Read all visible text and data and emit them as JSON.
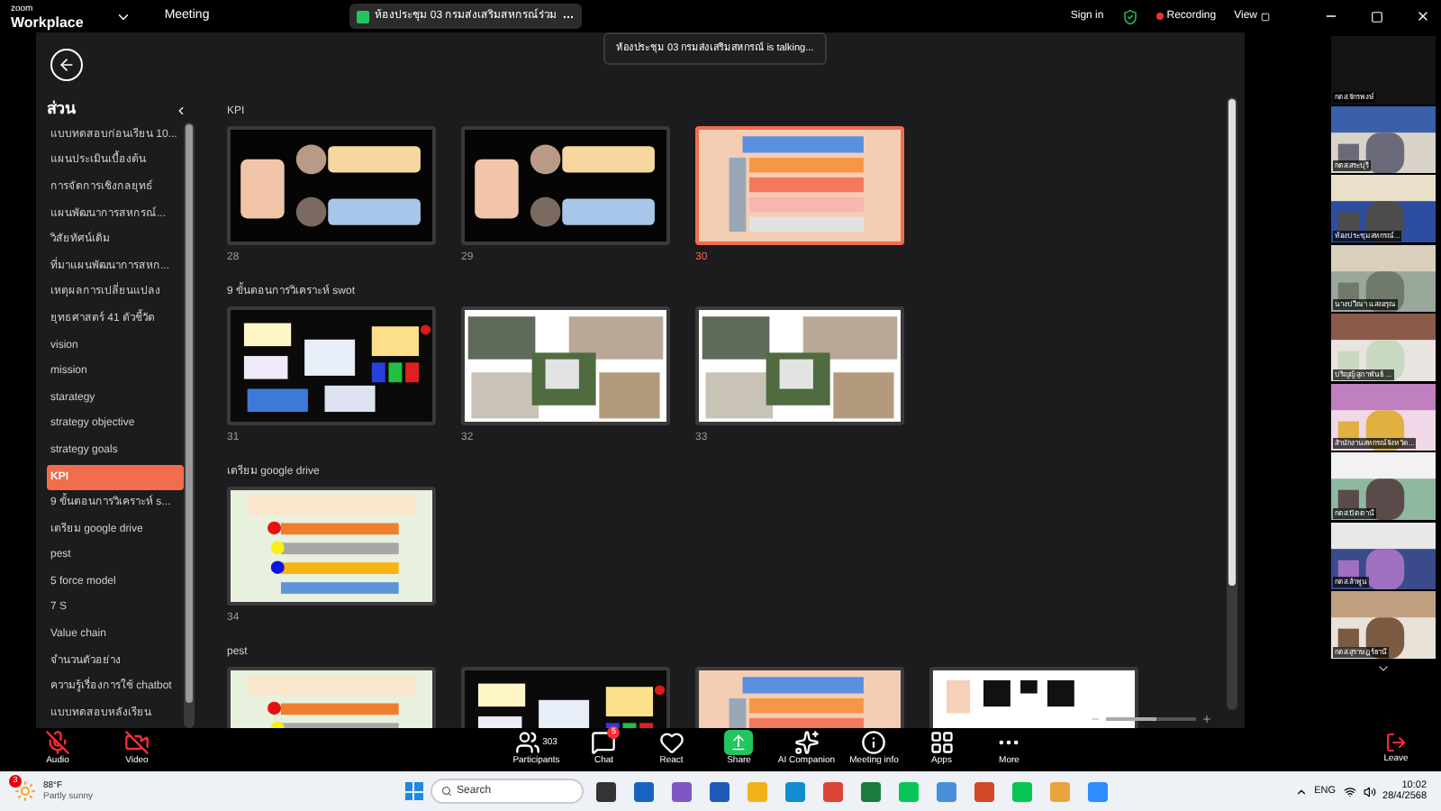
{
  "titlebar": {
    "brand_top": "zoom",
    "brand": "Workplace",
    "meeting": "Meeting",
    "room_pill": "ห้องประชุม 03 กรมส่งเสริมสหกรณ์ร่วม",
    "sign_in": "Sign in",
    "recording": "Recording",
    "view": "View"
  },
  "toast": "ห้องประชุม 03 กรมส่งเสริมสหกรณ์ is talking...",
  "sidebar": {
    "title": "ส่วน",
    "items": [
      {
        "label": "แบบทดสอบก่อนเรียน 10...",
        "selected": false
      },
      {
        "label": "แผนประเมินเบื้องต้น",
        "selected": false
      },
      {
        "label": "การจัดการเชิงกลยุทธ์",
        "selected": false
      },
      {
        "label": "แผนพัฒนาการสหกรณ์...",
        "selected": false
      },
      {
        "label": "วิสัยทัศน์เดิม",
        "selected": false
      },
      {
        "label": "ที่มาแผนพัฒนาการสหก...",
        "selected": false
      },
      {
        "label": "เหตุผลการเปลี่ยนแปลง",
        "selected": false
      },
      {
        "label": "ยุทธศาสตร์ 41 ตัวชี้วัด",
        "selected": false
      },
      {
        "label": "vision",
        "selected": false
      },
      {
        "label": "mission",
        "selected": false
      },
      {
        "label": "starategy",
        "selected": false
      },
      {
        "label": "strategy objective",
        "selected": false
      },
      {
        "label": "strategy goals",
        "selected": false
      },
      {
        "label": "KPI",
        "selected": true
      },
      {
        "label": "9 ขั้นตอนการวิเคราะห์ s...",
        "selected": false
      },
      {
        "label": "เตรียม google drive",
        "selected": false
      },
      {
        "label": "pest",
        "selected": false
      },
      {
        "label": "5 force model",
        "selected": false
      },
      {
        "label": "7 S",
        "selected": false
      },
      {
        "label": "Value chain",
        "selected": false
      },
      {
        "label": "จำนวนตัวอย่าง",
        "selected": false
      },
      {
        "label": "ความรู้เรื่องการใช้ chatbot",
        "selected": false
      },
      {
        "label": "แบบทดสอบหลังเรียน",
        "selected": false
      }
    ]
  },
  "sections": [
    {
      "title": "KPI",
      "slides": [
        {
          "number": "28",
          "kind": "kpi",
          "selected": false
        },
        {
          "number": "29",
          "kind": "kpi",
          "selected": false
        },
        {
          "number": "30",
          "kind": "keyword",
          "selected": true
        }
      ]
    },
    {
      "title": "9 ขั้นตอนการวิเคราะห์ swot",
      "slides": [
        {
          "number": "31",
          "kind": "chart",
          "selected": false
        },
        {
          "number": "32",
          "selected": false
        },
        {
          "number": "33",
          "selected": false
        }
      ]
    },
    {
      "title": "เตรียม google drive",
      "slides": [
        {
          "number": "34",
          "kind": "list",
          "selected": false
        }
      ]
    },
    {
      "title": "pest",
      "slides": [
        {
          "kind": "list",
          "selected": false
        },
        {
          "kind": "chart",
          "selected": false
        },
        {
          "kind": "keyword",
          "selected": false
        },
        {
          "kind": "qr",
          "selected": false
        }
      ]
    }
  ],
  "zoom_slider": {
    "level": 0.55
  },
  "videos": [
    "กตส.จักรพงษ์",
    "กตส.สระบุรี",
    "ห้องประชุมสหกรณ์...",
    "นางปวีณา แสงอรุณ",
    "ปริญญ์ สุภาพันธ์ ...",
    "สำนักงานสหกรณ์จังหวัด...",
    "กตส.ปัตตานี",
    "กตส.ลำพูน",
    "กตส.สุราษฎร์ธานี"
  ],
  "toolbar": [
    {
      "label": "Audio",
      "kind": "audio"
    },
    {
      "label": "Video",
      "kind": "video"
    },
    {
      "label": "Participants",
      "kind": "participants",
      "count": "303"
    },
    {
      "label": "Chat",
      "kind": "chat",
      "badge": "5"
    },
    {
      "label": "React",
      "kind": "react"
    },
    {
      "label": "Share",
      "kind": "share"
    },
    {
      "label": "AI Companion",
      "kind": "ai"
    },
    {
      "label": "Meeting info",
      "kind": "info"
    },
    {
      "label": "Apps",
      "kind": "apps"
    },
    {
      "label": "More",
      "kind": "more"
    }
  ],
  "leave": "Leave",
  "taskbar": {
    "weather_badge": "3",
    "temperature": "88°F",
    "weather": "Partly sunny",
    "search": "Search",
    "lang": "ENG",
    "time": "10:02",
    "date": "28/4/2568"
  }
}
